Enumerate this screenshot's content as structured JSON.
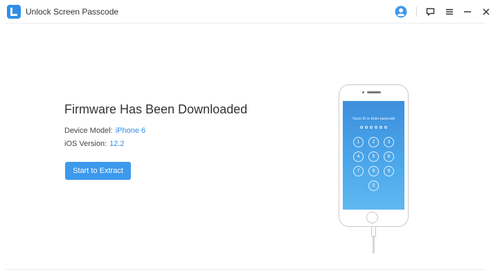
{
  "app": {
    "title": "Unlock Screen Passcode",
    "accent_color": "#3d99ec",
    "logo_icon": "app-logo-icon"
  },
  "titlebar": {
    "icons": [
      "user-account-icon",
      "feedback-icon",
      "menu-icon",
      "minimize-icon",
      "close-icon"
    ]
  },
  "main": {
    "heading": "Firmware Has Been Downloaded",
    "device_model_label": "Device Model:",
    "device_model_value": "iPhone 6",
    "ios_version_label": "iOS Version:",
    "ios_version_value": "12.2",
    "extract_button_label": "Start to Extract"
  },
  "phone": {
    "screen_prompt": "Touch ID or Enter passcode",
    "passcode_dots": 6,
    "keys": [
      "1",
      "2",
      "3",
      "4",
      "5",
      "6",
      "7",
      "8",
      "9",
      "0"
    ]
  }
}
